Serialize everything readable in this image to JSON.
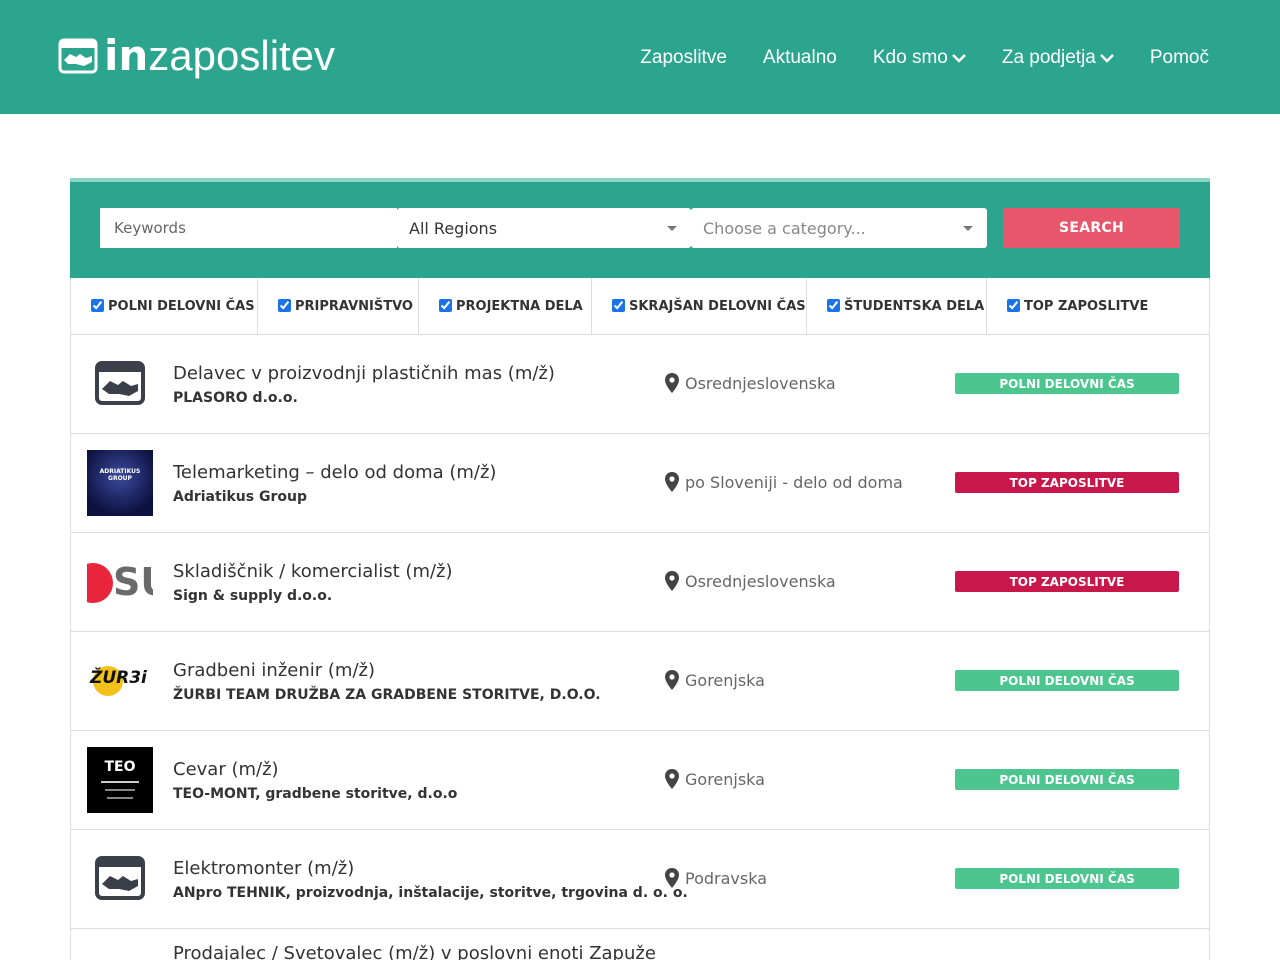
{
  "brand": {
    "logo_bold": "in",
    "logo_light": "zaposlitev",
    "color": "#2ba58e"
  },
  "nav": {
    "items": [
      {
        "label": "Zaposlitve",
        "dropdown": false
      },
      {
        "label": "Aktualno",
        "dropdown": false
      },
      {
        "label": "Kdo smo",
        "dropdown": true
      },
      {
        "label": "Za podjetja",
        "dropdown": true
      },
      {
        "label": "Pomoč",
        "dropdown": false
      }
    ]
  },
  "search": {
    "keywords_placeholder": "Keywords",
    "region_selected": "All Regions",
    "category_placeholder": "Choose a category...",
    "button_label": "SEARCH",
    "button_color": "#e8566b"
  },
  "filters": [
    {
      "label": "POLNI DELOVNI ČAS",
      "checked": true
    },
    {
      "label": "PRIPRAVNIŠTVO",
      "checked": true
    },
    {
      "label": "PROJEKTNA DELA",
      "checked": true
    },
    {
      "label": "SKRAJŠAN DELOVNI ČAS",
      "checked": true
    },
    {
      "label": "ŠTUDENTSKA DELA",
      "checked": true
    },
    {
      "label": "TOP ZAPOSLITVE",
      "checked": true
    }
  ],
  "jobs": [
    {
      "title": "Delavec v proizvodnji plastičnih mas (m/ž)",
      "company": "PLASORO d.o.o.",
      "location": "Osrednjeslovenska",
      "badge": "POLNI DELOVNI ČAS",
      "badge_type": "full",
      "logo": "handshake-icon"
    },
    {
      "title": "Telemarketing – delo od doma (m/ž)",
      "company": "Adriatikus Group",
      "location": "po Sloveniji - delo od doma",
      "badge": "TOP ZAPOSLITVE",
      "badge_type": "top",
      "logo": "adriatikus-logo",
      "logo_text": "ADRIATIKUS GROUP"
    },
    {
      "title": "Skladiščnik / komercialist (m/ž)",
      "company": "Sign & supply d.o.o.",
      "location": "Osrednjeslovenska",
      "badge": "TOP ZAPOSLITVE",
      "badge_type": "top",
      "logo": "sign-supply-logo",
      "logo_text": "SU"
    },
    {
      "title": "Gradbeni inženir (m/ž)",
      "company": "ŽURBI TEAM DRUŽBA ZA GRADBENE STORITVE, D.O.O.",
      "location": "Gorenjska",
      "badge": "POLNI DELOVNI ČAS",
      "badge_type": "full",
      "logo": "zurbi-logo",
      "logo_text": "ŽUR3i"
    },
    {
      "title": "Cevar (m/ž)",
      "company": "TEO-MONT, gradbene storitve, d.o.o",
      "location": "Gorenjska",
      "badge": "POLNI DELOVNI ČAS",
      "badge_type": "full",
      "logo": "teo-mont-logo",
      "logo_text": "TEO"
    },
    {
      "title": "Elektromonter (m/ž)",
      "company": "ANpro TEHNIK, proizvodnja, inštalacije, storitve, trgovina d. o. o.",
      "location": "Podravska",
      "badge": "POLNI DELOVNI ČAS",
      "badge_type": "full",
      "logo": "handshake-icon"
    },
    {
      "title": "Prodajalec / Svetovalec (m/ž) v poslovni enoti Zapuže",
      "partial": true
    }
  ]
}
